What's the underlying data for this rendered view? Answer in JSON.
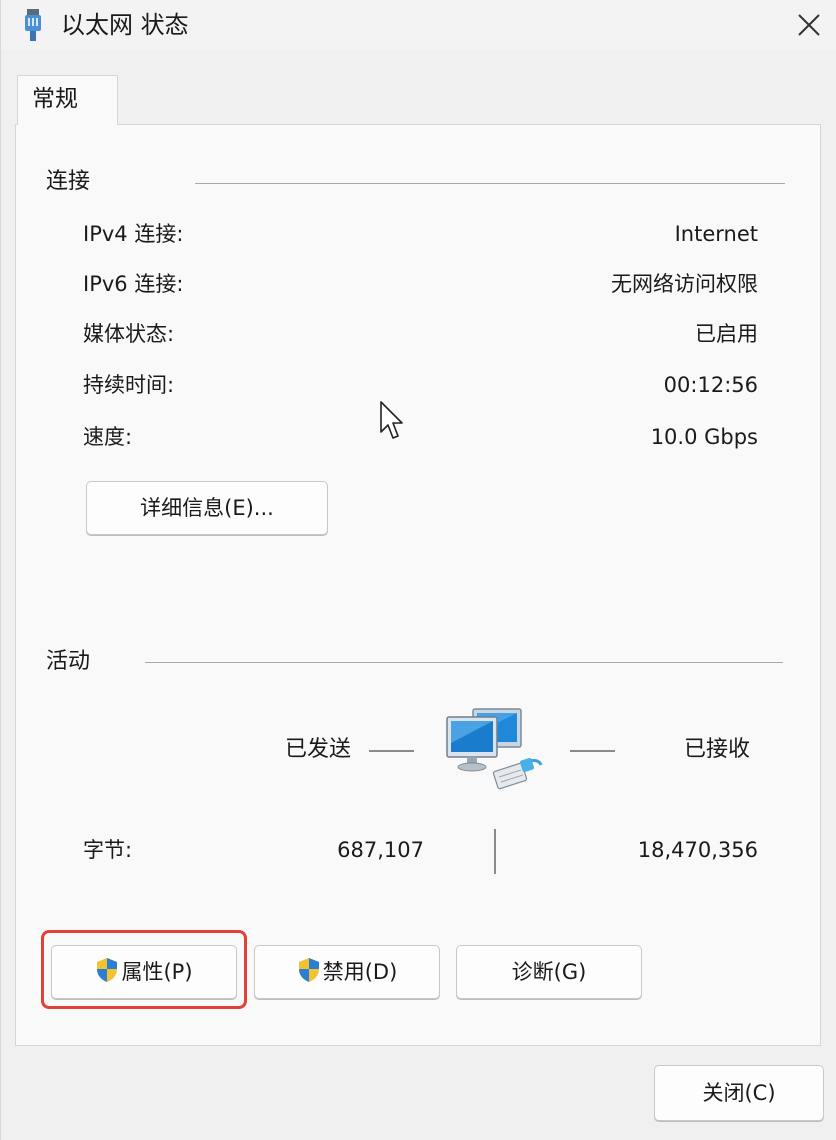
{
  "window": {
    "title": "以太网 状态",
    "icon": "ethernet-plug-icon"
  },
  "tabs": [
    {
      "label": "常规",
      "selected": true
    }
  ],
  "connection": {
    "heading": "连接",
    "rows": [
      {
        "label": "IPv4 连接:",
        "value": "Internet"
      },
      {
        "label": "IPv6 连接:",
        "value": "无网络访问权限"
      },
      {
        "label": "媒体状态:",
        "value": "已启用"
      },
      {
        "label": "持续时间:",
        "value": "00:12:56"
      },
      {
        "label": "速度:",
        "value": "10.0 Gbps"
      }
    ],
    "details_button": "详细信息(E)..."
  },
  "activity": {
    "heading": "活动",
    "sent_label": "已发送",
    "received_label": "已接收",
    "bytes_label": "字节:",
    "bytes_sent": "687,107",
    "bytes_received": "18,470,356"
  },
  "buttons": {
    "properties": "属性(P)",
    "disable": "禁用(D)",
    "diagnose": "诊断(G)",
    "close": "关闭(C)"
  },
  "colors": {
    "highlight": "#e0423a",
    "accent": "#1e88d9",
    "shield_blue": "#2a7fd4",
    "shield_yellow": "#f2c230"
  }
}
